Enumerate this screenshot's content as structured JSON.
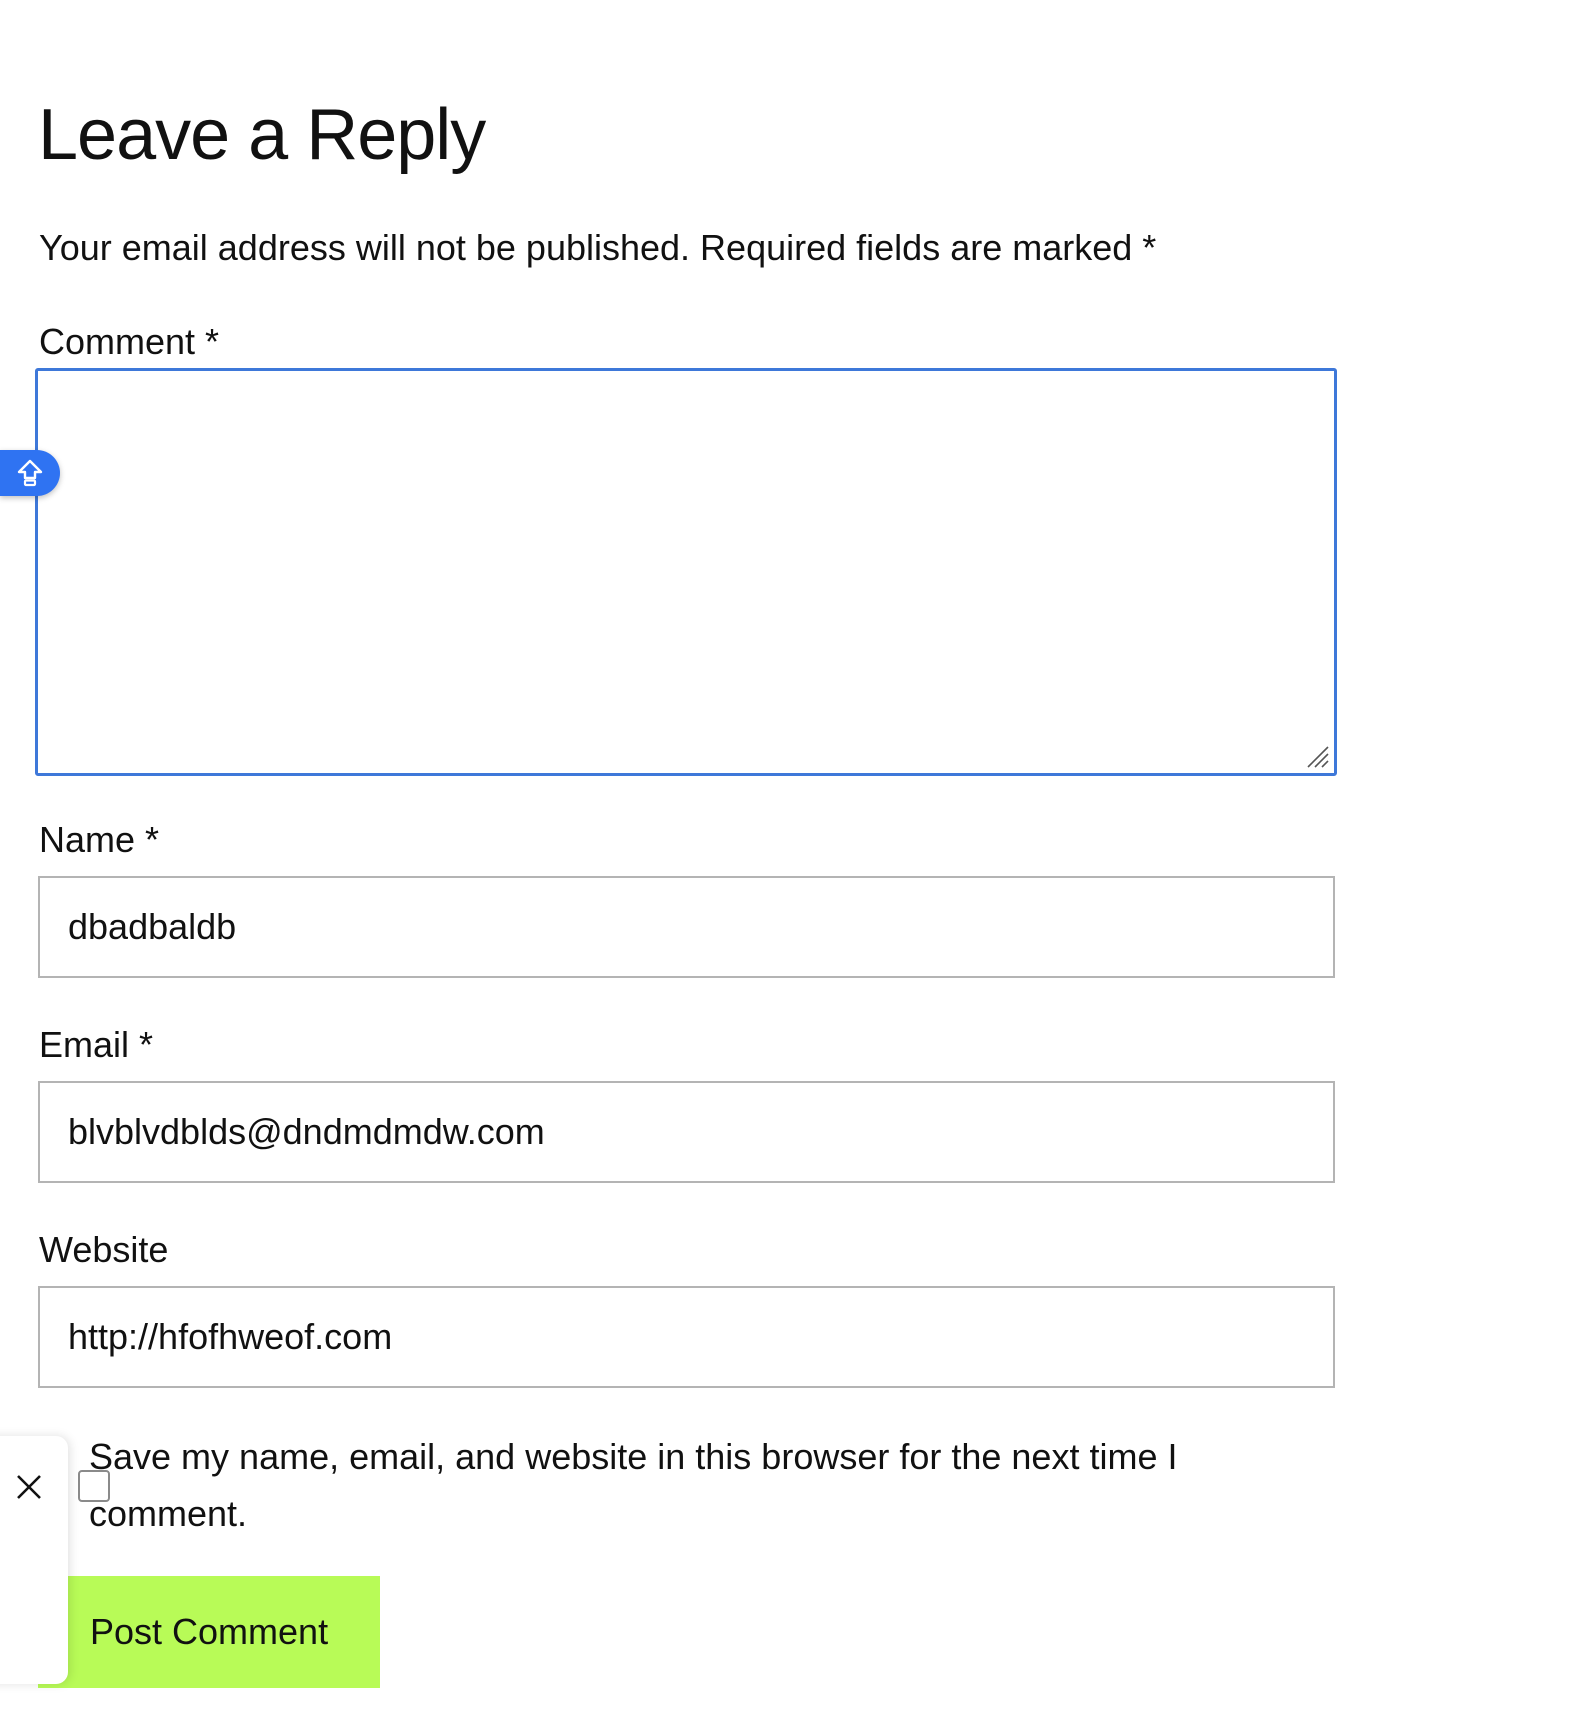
{
  "heading": "Leave a Reply",
  "notes": "Your email address will not be published. Required fields are marked *",
  "fields": {
    "comment": {
      "label": "Comment *",
      "value": ""
    },
    "name": {
      "label": "Name *",
      "value": "dbadbaldb"
    },
    "email": {
      "label": "Email *",
      "value": "blvblvdblds@dndmdmdw.com"
    },
    "website": {
      "label": "Website",
      "value": "http://hfofhweof.com"
    }
  },
  "consent": {
    "label": "Save my name, email, and website in this browser for the next time I comment.",
    "checked": false
  },
  "submit": {
    "label": "Post Comment"
  },
  "icons": {
    "extension": "upload-arrow-icon",
    "close": "close-icon",
    "resize": "resize-grip-icon"
  },
  "colors": {
    "focus_border": "#3e78d9",
    "extension_bubble": "#2f73f2",
    "submit_background": "#b8fb57",
    "input_border": "#b4b4b4"
  }
}
